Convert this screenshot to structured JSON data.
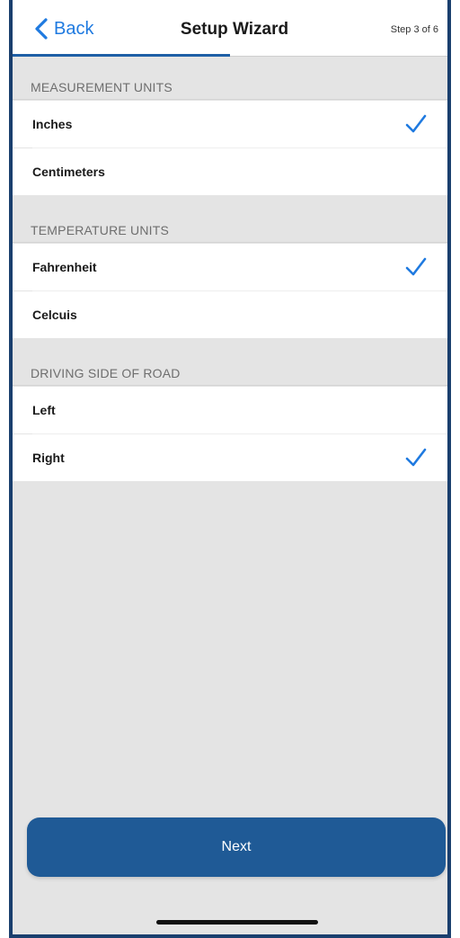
{
  "nav": {
    "back_label": "Back",
    "title": "Setup Wizard",
    "step": "Step 3 of 6",
    "progress_fraction": 0.5
  },
  "sections": [
    {
      "header": "MEASUREMENT UNITS",
      "options": [
        {
          "label": "Inches",
          "selected": true
        },
        {
          "label": "Centimeters",
          "selected": false
        }
      ]
    },
    {
      "header": "TEMPERATURE UNITS",
      "options": [
        {
          "label": "Fahrenheit",
          "selected": true
        },
        {
          "label": "Celcuis",
          "selected": false
        }
      ]
    },
    {
      "header": "DRIVING SIDE OF ROAD",
      "options": [
        {
          "label": "Left",
          "selected": false
        },
        {
          "label": "Right",
          "selected": true
        }
      ]
    }
  ],
  "next_label": "Next",
  "colors": {
    "accent": "#1f7ae0",
    "button": "#1f5a96",
    "background": "#e4e4e4"
  },
  "icons": {
    "back": "chevron-left-icon",
    "selected": "checkmark-icon"
  }
}
